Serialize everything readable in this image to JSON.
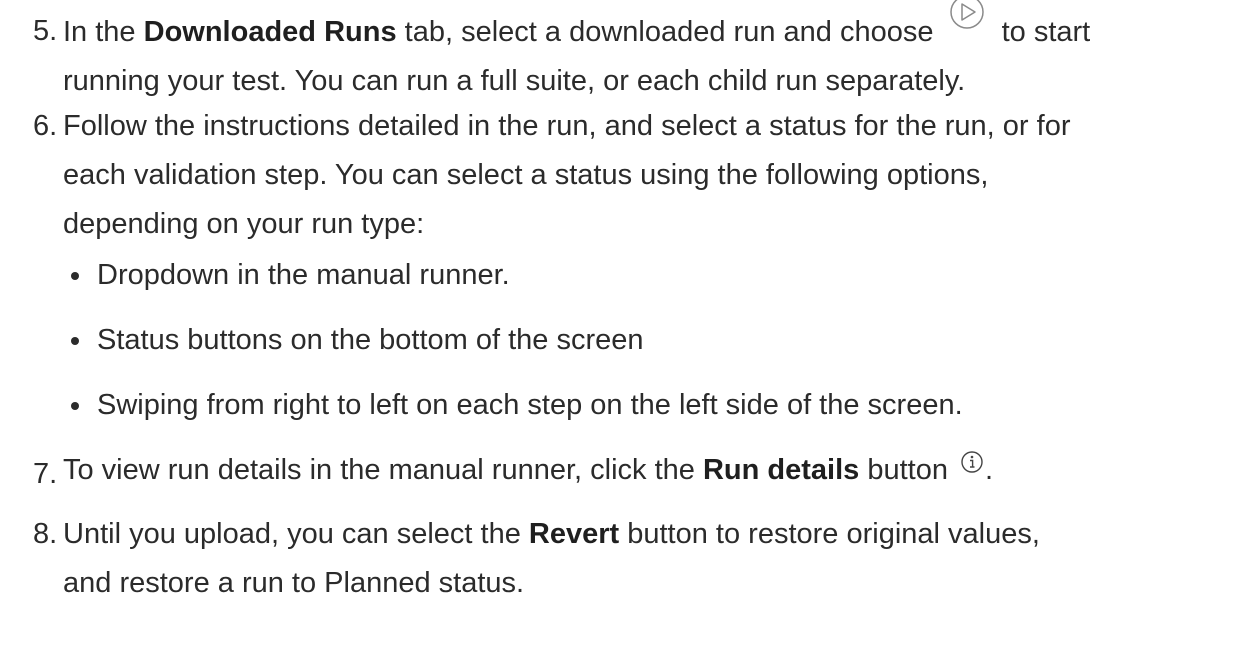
{
  "steps": [
    {
      "number": "5.",
      "line1_pre": "In the ",
      "line1_bold": "Downloaded Runs",
      "line1_mid": " tab, select a downloaded run and choose ",
      "line1_post": " to start",
      "line2": "running your test. You can run a full suite, or each child run separately.",
      "icon": "play-circle-icon"
    },
    {
      "number": "6.",
      "line1": "Follow the instructions detailed in the run, and select a status for the run, or for",
      "line2": "each validation step. You can select a status using the following options,",
      "line3": "depending on your run type:",
      "bullets": [
        "Dropdown in the manual runner.",
        "Status buttons on the bottom of the screen",
        "Swiping from right to left on each step on the left side of the screen."
      ]
    },
    {
      "number": "7.",
      "line1_pre": "To view run details in the manual runner, click the ",
      "line1_bold": "Run details",
      "line1_post": " button ",
      "line1_end": ".",
      "icon": "info-circle-icon"
    },
    {
      "number": "8.",
      "line1_pre": "Until you upload, you can select the ",
      "line1_bold": "Revert",
      "line1_post": " button to restore original values,",
      "line2": "and restore a run to Planned status."
    }
  ]
}
